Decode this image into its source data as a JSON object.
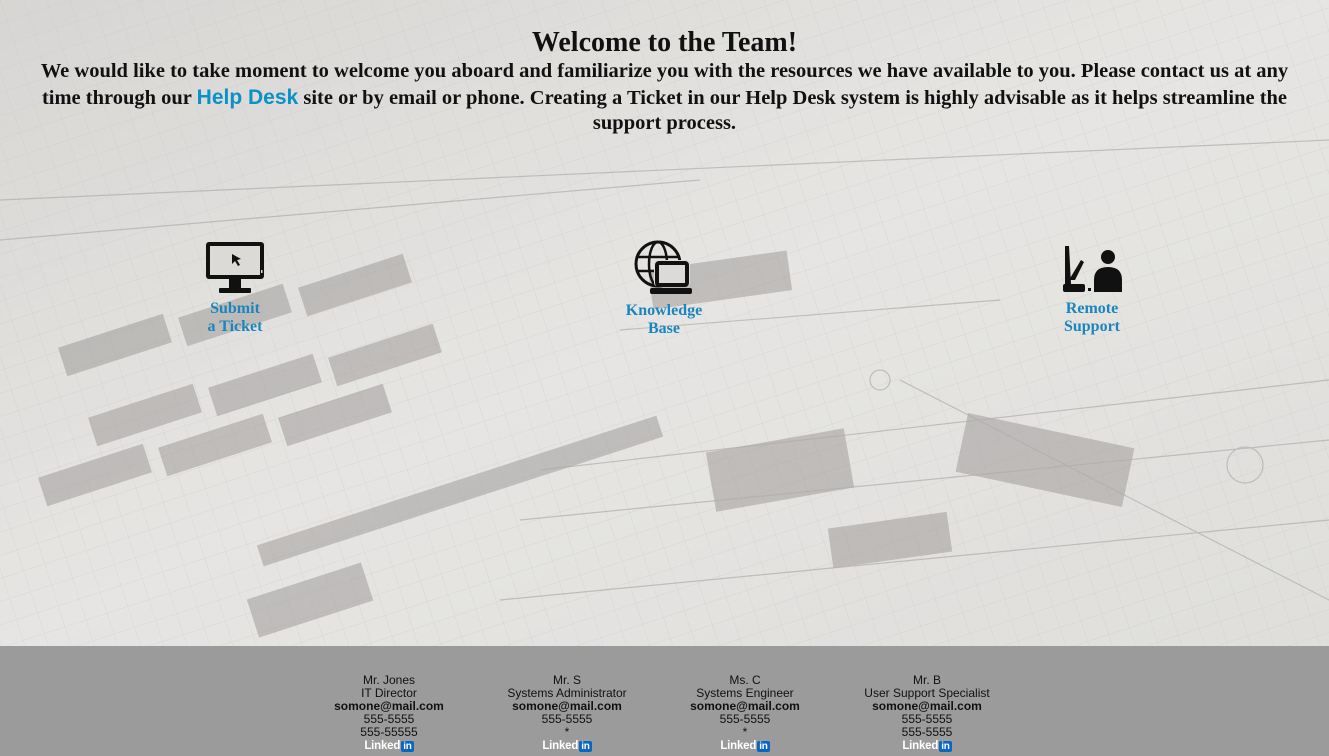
{
  "intro": {
    "title": "Welcome to the Team!",
    "text_before_link": "We would like to take moment to welcome you aboard and familiarize you with the resources we have available to you. Please contact us at any time through our ",
    "link_label": "Help Desk",
    "text_after_link": " site or by email or phone. Creating a Ticket in our Help Desk system is highly advisable as it helps streamline the support process."
  },
  "resources": [
    {
      "label": "Submit\na Ticket",
      "icon": "monitor-cursor-icon"
    },
    {
      "label": "Knowledge\nBase",
      "icon": "globe-laptop-icon"
    },
    {
      "label": "Remote\nSupport",
      "icon": "remote-support-icon"
    }
  ],
  "contacts": [
    {
      "name": "Mr. Jones",
      "title": "IT Director",
      "email": "somone@mail.com",
      "phone1": "555-5555",
      "phone2": "555-55555",
      "social": "Linked",
      "social_badge": "in"
    },
    {
      "name": "Mr. S",
      "title": "Systems Administrator",
      "email": "somone@mail.com",
      "phone1": "555-5555",
      "phone2": "*",
      "social": "Linked",
      "social_badge": "in"
    },
    {
      "name": "Ms. C",
      "title": "Systems Engineer",
      "email": "somone@mail.com",
      "phone1": "555-5555",
      "phone2": "*",
      "social": "Linked",
      "social_badge": "in"
    },
    {
      "name": "Mr. B",
      "title": "User Support Specialist",
      "email": "somone@mail.com",
      "phone1": "555-5555",
      "phone2": "555-5555",
      "social": "Linked",
      "social_badge": "in"
    }
  ],
  "colors": {
    "link": "#0a91c8",
    "resource_label": "#1a86bd",
    "footer_bg": "#9b9b9b",
    "linkedin": "#0a66c2"
  }
}
